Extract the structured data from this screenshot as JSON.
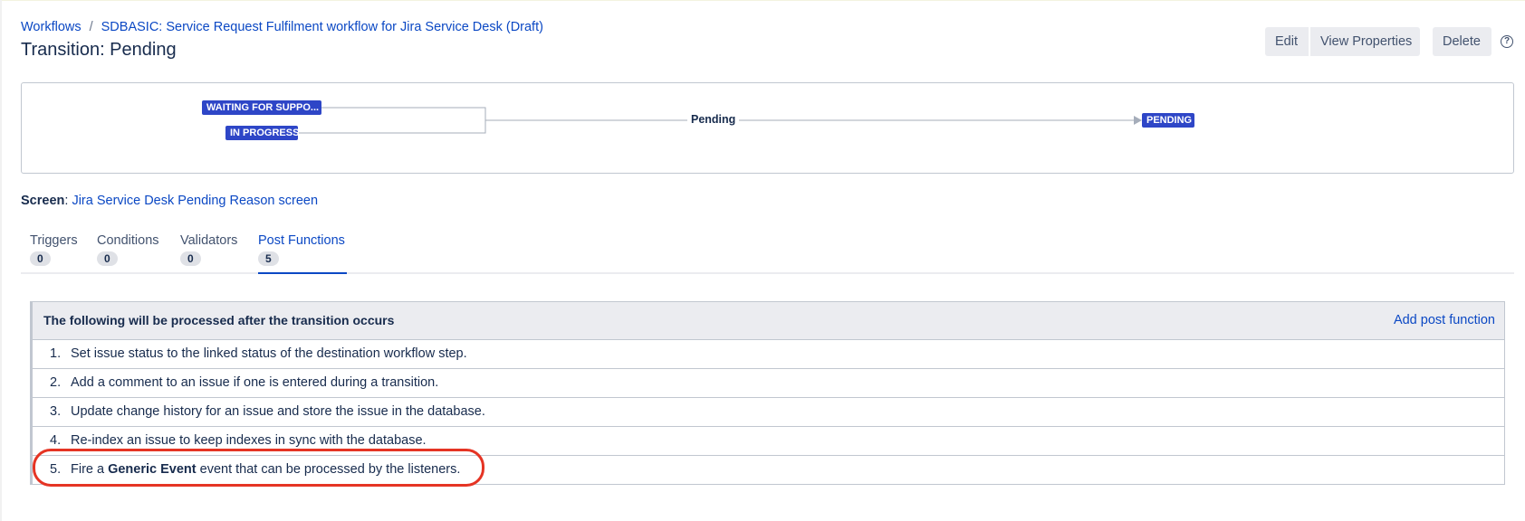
{
  "breadcrumb": {
    "workflows": "Workflows",
    "separator": "/",
    "workflow_name": "SDBASIC: Service Request Fulfilment workflow for Jira Service Desk (Draft)"
  },
  "page_title": "Transition: Pending",
  "actions": {
    "edit": "Edit",
    "view_properties": "View Properties",
    "delete": "Delete",
    "help_icon": "question-circle-icon"
  },
  "diagram": {
    "from_statuses": [
      "WAITING FOR SUPPO...",
      "IN PROGRESS"
    ],
    "transition": "Pending",
    "to_status": "PENDING",
    "colors": {
      "lozenge": "#2e46c7",
      "line": "#a5adba"
    }
  },
  "screen": {
    "label": "Screen",
    "value": "Jira Service Desk Pending Reason screen"
  },
  "tabs": [
    {
      "label": "Triggers",
      "count": "0"
    },
    {
      "label": "Conditions",
      "count": "0"
    },
    {
      "label": "Validators",
      "count": "0"
    },
    {
      "label": "Post Functions",
      "count": "5",
      "active": true
    }
  ],
  "post_functions": {
    "header": "The following will be processed after the transition occurs",
    "add_link": "Add post function",
    "items": [
      {
        "num": "1.",
        "text": "Set issue status to the linked status of the destination workflow step."
      },
      {
        "num": "2.",
        "text": "Add a comment to an issue if one is entered during a transition."
      },
      {
        "num": "3.",
        "text": "Update change history for an issue and store the issue in the database."
      },
      {
        "num": "4.",
        "text": "Re-index an issue to keep indexes in sync with the database."
      },
      {
        "num": "5.",
        "prefix": "Fire a ",
        "bold": "Generic Event",
        "suffix": " event that can be processed by the listeners."
      }
    ]
  },
  "annotation": {
    "color": "#e53424"
  },
  "colors": {
    "link": "#0b48c4",
    "text": "#172b4d",
    "button_bg": "#ebecf0"
  }
}
